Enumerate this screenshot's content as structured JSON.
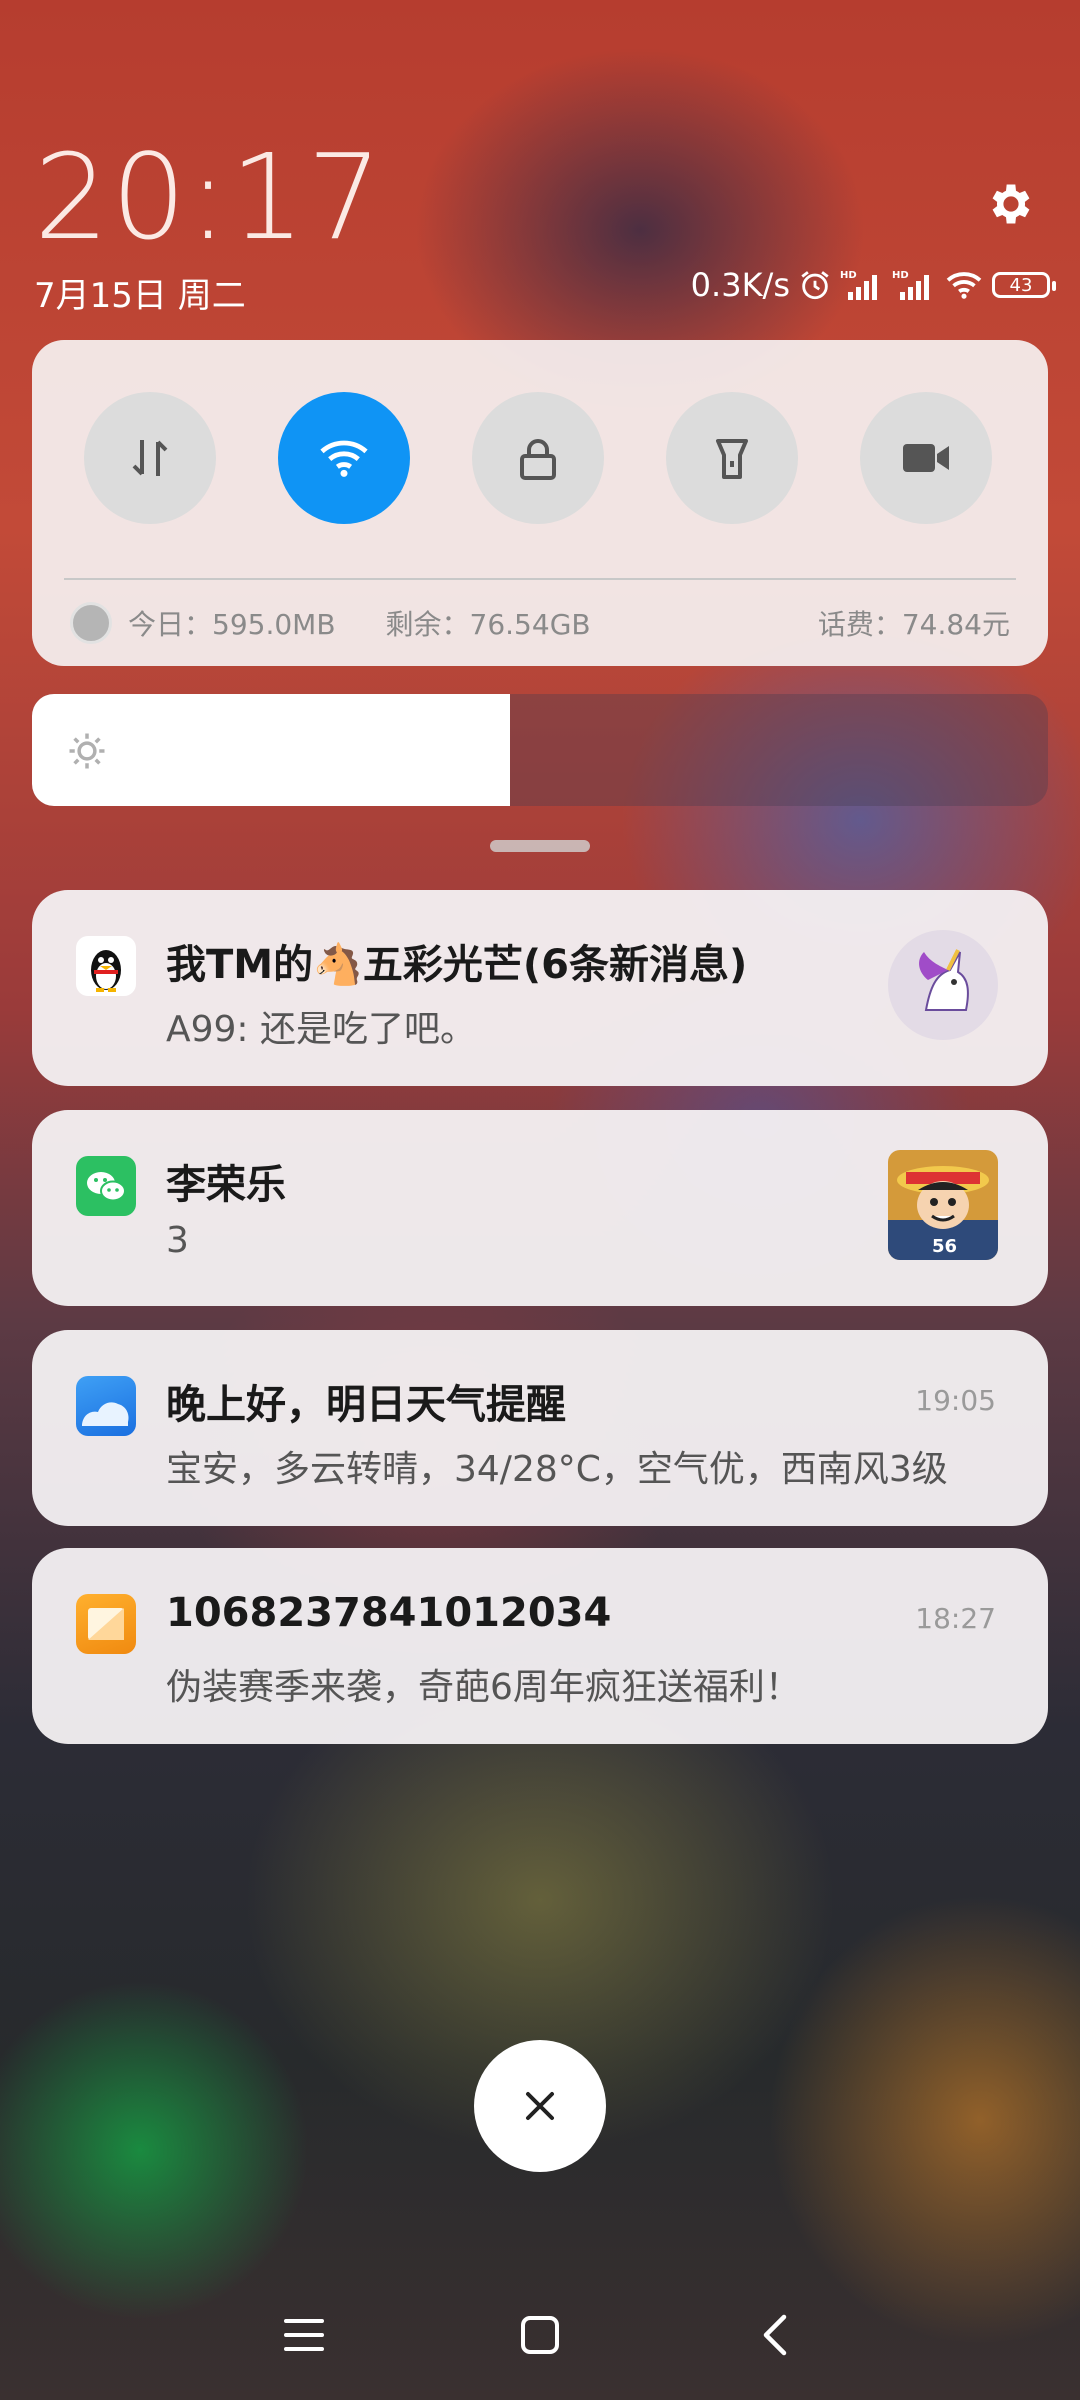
{
  "status": {
    "time": "20:17",
    "date": "7月15日 周二",
    "net_speed": "0.3K/s",
    "battery": "43"
  },
  "quick_settings": {
    "toggles": [
      {
        "icon": "mobile-data-icon",
        "active": false
      },
      {
        "icon": "wifi-icon",
        "active": true
      },
      {
        "icon": "lock-icon",
        "active": false
      },
      {
        "icon": "flashlight-icon",
        "active": false
      },
      {
        "icon": "video-camera-icon",
        "active": false
      }
    ],
    "data_today": "今日：595.0MB",
    "data_remaining": "剩余：76.54GB",
    "balance": "话费：74.84元"
  },
  "brightness": {
    "level": 0.47
  },
  "notifications": [
    {
      "app": "qq",
      "title": "我TM的🐴五彩光芒(6条新消息)",
      "body": "A99: 还是吃了吧。",
      "time": ""
    },
    {
      "app": "wechat",
      "title": "李荣乐",
      "body": "3",
      "time": ""
    },
    {
      "app": "weather",
      "title": "晚上好，明日天气提醒",
      "body": "宝安，多云转晴，34/28°C，空气优，西南风3级",
      "time": "19:05"
    },
    {
      "app": "messages",
      "title": "1068237841012034",
      "body": "伪装赛季来袭，奇葩6周年疯狂送福利！",
      "time": "18:27"
    }
  ],
  "colors": {
    "accent": "#0f94f5",
    "wechat": "#2cc062"
  }
}
